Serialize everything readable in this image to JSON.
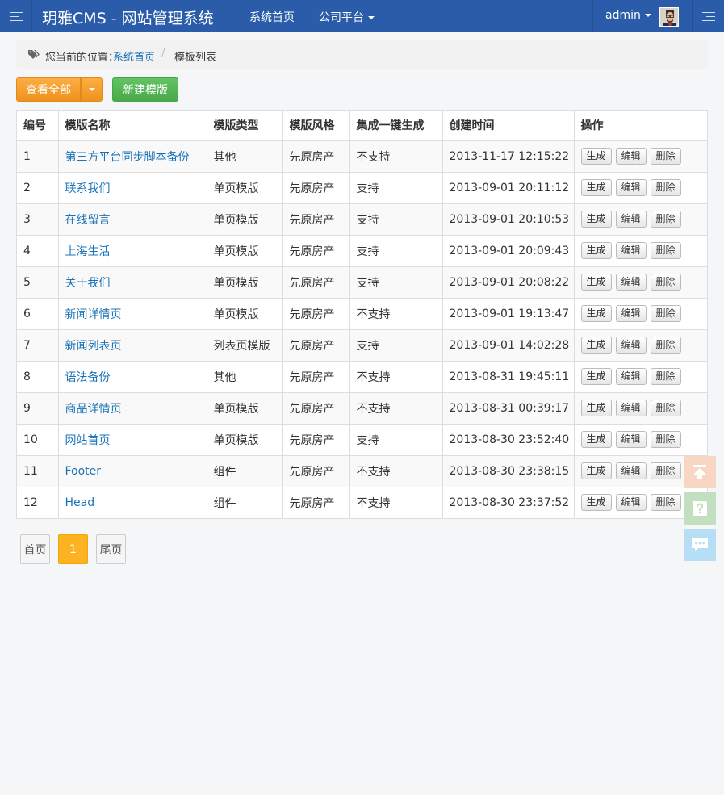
{
  "navbar": {
    "brand": "玥雅CMS - 网站管理系统",
    "links": [
      {
        "label": "系统首页"
      },
      {
        "label": "公司平台"
      }
    ],
    "user": "admin"
  },
  "breadcrumb": {
    "label": "您当前的位置：",
    "home": "系统首页",
    "separator": "/",
    "current": "模板列表"
  },
  "toolbar": {
    "view_all": "查看全部",
    "new_template": "新建模版"
  },
  "table": {
    "headers": [
      "编号",
      "模版名称",
      "模版类型",
      "模版风格",
      "集成一键生成",
      "创建时间",
      "操作"
    ],
    "action_labels": {
      "generate": "生成",
      "edit": "编辑",
      "delete": "删除"
    },
    "rows": [
      {
        "id": "1",
        "name": "第三方平台同步脚本备份",
        "type": "其他",
        "style": "先原房产",
        "oneclick": "不支持",
        "created": "2013-11-17 12:15:22"
      },
      {
        "id": "2",
        "name": "联系我们",
        "type": "单页模版",
        "style": "先原房产",
        "oneclick": "支持",
        "created": "2013-09-01 20:11:12"
      },
      {
        "id": "3",
        "name": "在线留言",
        "type": "单页模版",
        "style": "先原房产",
        "oneclick": "支持",
        "created": "2013-09-01 20:10:53"
      },
      {
        "id": "4",
        "name": "上海生活",
        "type": "单页模版",
        "style": "先原房产",
        "oneclick": "支持",
        "created": "2013-09-01 20:09:43"
      },
      {
        "id": "5",
        "name": "关于我们",
        "type": "单页模版",
        "style": "先原房产",
        "oneclick": "支持",
        "created": "2013-09-01 20:08:22"
      },
      {
        "id": "6",
        "name": "新闻详情页",
        "type": "单页模版",
        "style": "先原房产",
        "oneclick": "不支持",
        "created": "2013-09-01 19:13:47"
      },
      {
        "id": "7",
        "name": "新闻列表页",
        "type": "列表页模版",
        "style": "先原房产",
        "oneclick": "支持",
        "created": "2013-09-01 14:02:28"
      },
      {
        "id": "8",
        "name": "语法备份",
        "type": "其他",
        "style": "先原房产",
        "oneclick": "不支持",
        "created": "2013-08-31 19:45:11"
      },
      {
        "id": "9",
        "name": "商品详情页",
        "type": "单页模版",
        "style": "先原房产",
        "oneclick": "不支持",
        "created": "2013-08-31 00:39:17"
      },
      {
        "id": "10",
        "name": "网站首页",
        "type": "单页模版",
        "style": "先原房产",
        "oneclick": "支持",
        "created": "2013-08-30 23:52:40"
      },
      {
        "id": "11",
        "name": "Footer",
        "type": "组件",
        "style": "先原房产",
        "oneclick": "不支持",
        "created": "2013-08-30 23:38:15"
      },
      {
        "id": "12",
        "name": "Head",
        "type": "组件",
        "style": "先原房产",
        "oneclick": "不支持",
        "created": "2013-08-30 23:37:52"
      }
    ]
  },
  "pagination": {
    "first": "首页",
    "current": "1",
    "last": "尾页"
  },
  "floating": {
    "top_icon": "arrow-up-icon",
    "help_icon": "question-icon",
    "chat_icon": "chat-icon"
  },
  "colors": {
    "navbar": "#2a5caa",
    "link": "#1a73b8",
    "orange_button": "#f0921c",
    "green_button": "#4aa94a",
    "active_page": "#fbb321"
  }
}
